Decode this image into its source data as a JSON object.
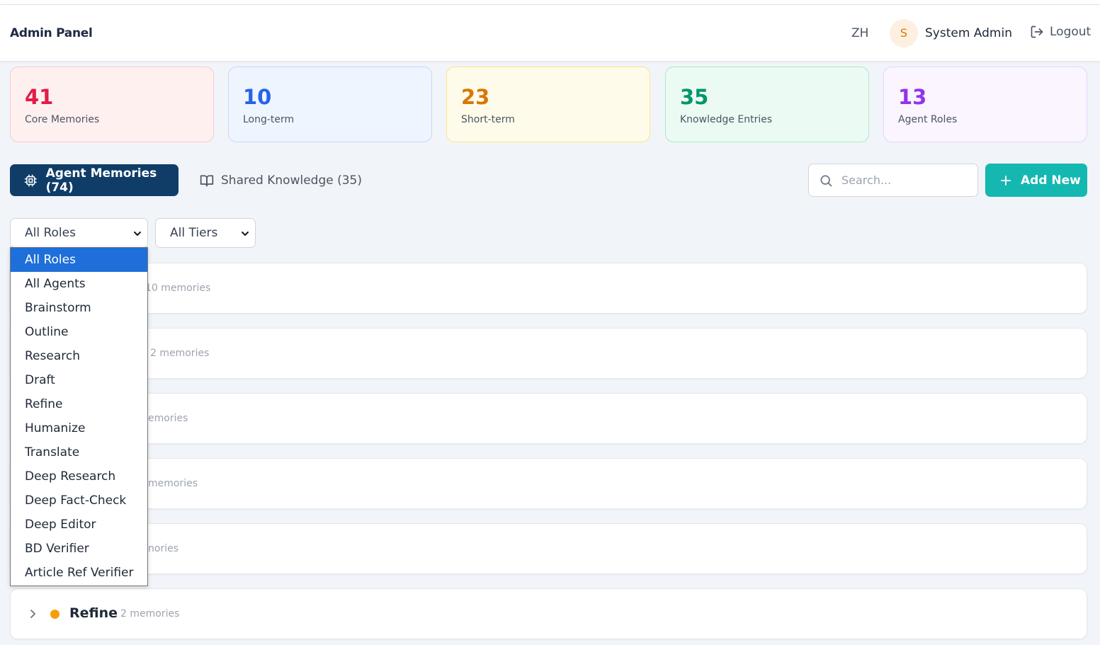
{
  "header": {
    "title": "Admin Panel",
    "lang": "ZH",
    "avatar_initial": "S",
    "user_name": "System Admin",
    "logout_label": "Logout"
  },
  "stats": [
    {
      "value": "41",
      "label": "Core Memories"
    },
    {
      "value": "10",
      "label": "Long-term"
    },
    {
      "value": "23",
      "label": "Short-term"
    },
    {
      "value": "35",
      "label": "Knowledge Entries"
    },
    {
      "value": "13",
      "label": "Agent Roles"
    }
  ],
  "tabs": {
    "agent_memories": "Agent Memories (74)",
    "shared_knowledge": "Shared Knowledge (35)"
  },
  "search": {
    "placeholder": "Search..."
  },
  "add_new_label": "Add New",
  "filters": {
    "role_selected": "All Roles",
    "tier_selected": "All Tiers",
    "role_options": [
      "All Roles",
      "All Agents",
      "Brainstorm",
      "Outline",
      "Research",
      "Draft",
      "Refine",
      "Humanize",
      "Translate",
      "Deep Research",
      "Deep Fact-Check",
      "Deep Editor",
      "BD Verifier",
      "Article Ref Verifier"
    ]
  },
  "groups": [
    {
      "visible_count": "10 memories"
    },
    {
      "visible_count": "2 memories"
    },
    {
      "visible_count": "emories"
    },
    {
      "visible_count": "memories"
    },
    {
      "visible_count": "nories"
    },
    {
      "name": "Refine",
      "count": "2 memories",
      "dot_color": "#f59e0b"
    }
  ],
  "colors": {
    "primary": "#0f3d68",
    "accent": "#14b8b0",
    "dropdown_highlight": "#1e6fd9"
  }
}
